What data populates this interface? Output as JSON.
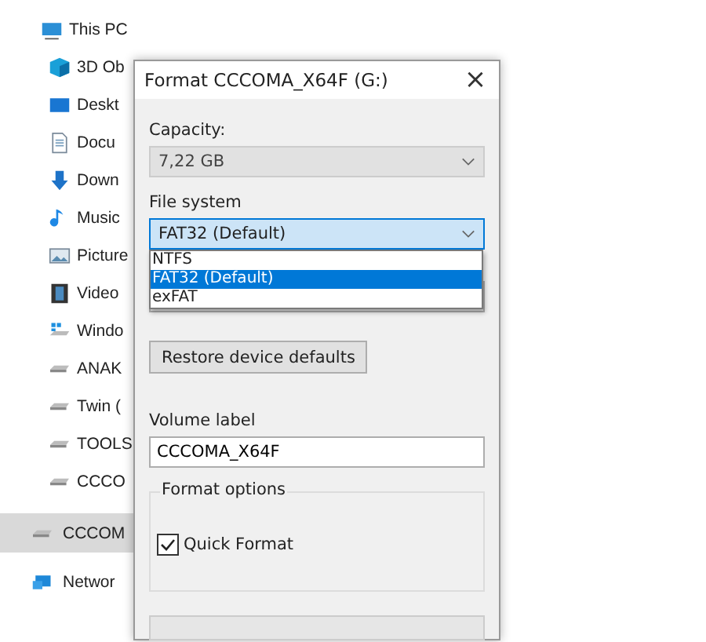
{
  "sidebar": {
    "root": {
      "label": "This PC",
      "children": [
        {
          "label": "3D Ob"
        },
        {
          "label": "Deskt"
        },
        {
          "label": "Docu"
        },
        {
          "label": "Down"
        },
        {
          "label": "Music"
        },
        {
          "label": "Picture"
        },
        {
          "label": "Video"
        },
        {
          "label": "Windo"
        },
        {
          "label": "ANAK"
        },
        {
          "label": "Twin ("
        },
        {
          "label": "TOOLS"
        },
        {
          "label": "CCCO"
        }
      ]
    },
    "items": [
      {
        "label": "CCCOM",
        "selected": true
      },
      {
        "label": "Networ",
        "selected": false
      }
    ]
  },
  "dialog": {
    "title": "Format CCCOMA_X64F (G:)",
    "close": "×",
    "capacity": {
      "label": "Capacity:",
      "value": "7,22 GB",
      "disabled": true
    },
    "file_system": {
      "label": "File system",
      "value": "FAT32 (Default)",
      "expanded": true,
      "options": [
        {
          "label": "NTFS",
          "selected": false
        },
        {
          "label": "FAT32 (Default)",
          "selected": true
        },
        {
          "label": "exFAT",
          "selected": false
        }
      ]
    },
    "restore_button": "Restore device defaults",
    "volume_label": {
      "label": "Volume label",
      "value": "CCCOMA_X64F"
    },
    "format_options": {
      "legend": "Format options",
      "quick_format": {
        "label": "Quick Format",
        "checked": true
      }
    },
    "progress": {
      "level": 0
    }
  }
}
